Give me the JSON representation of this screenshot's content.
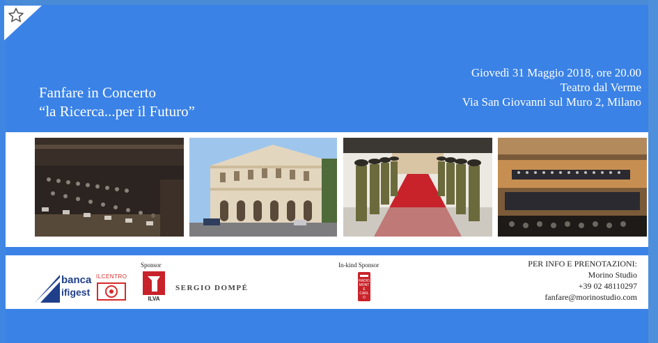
{
  "title": {
    "line1": "Fanfare in Concerto",
    "line2": "“la Ricerca...per il Futuro”"
  },
  "event": {
    "date": "Giovedì 31 Maggio 2018, ore 20.00",
    "venue": "Teatro dal Verme",
    "address": "Via San Giovanni sul Muro 2, Milano"
  },
  "sponsors": {
    "sponsor_label": "Sponsor",
    "inkind_label": "In-kind Sponsor",
    "banca_line1": "banca",
    "banca_line2": "ifigest",
    "ilcentro": "ILCENTRO",
    "ilva": "ILVA",
    "dompe": "SERGIO DOMPÉ",
    "radio": "RADIO MONTE CARLO"
  },
  "info": {
    "heading": "PER INFO E PRENOTAZIONI:",
    "contact": "Morino Studio",
    "phone": "+39 02 48110297",
    "email": "fanfare@morinostudio.com"
  },
  "colors": {
    "background_blue": "#3a82e6",
    "white": "#ffffff",
    "carpet_red": "#c8222a",
    "banca_blue": "#1f3f8a"
  },
  "icons": {
    "bookmark": "star-icon"
  }
}
